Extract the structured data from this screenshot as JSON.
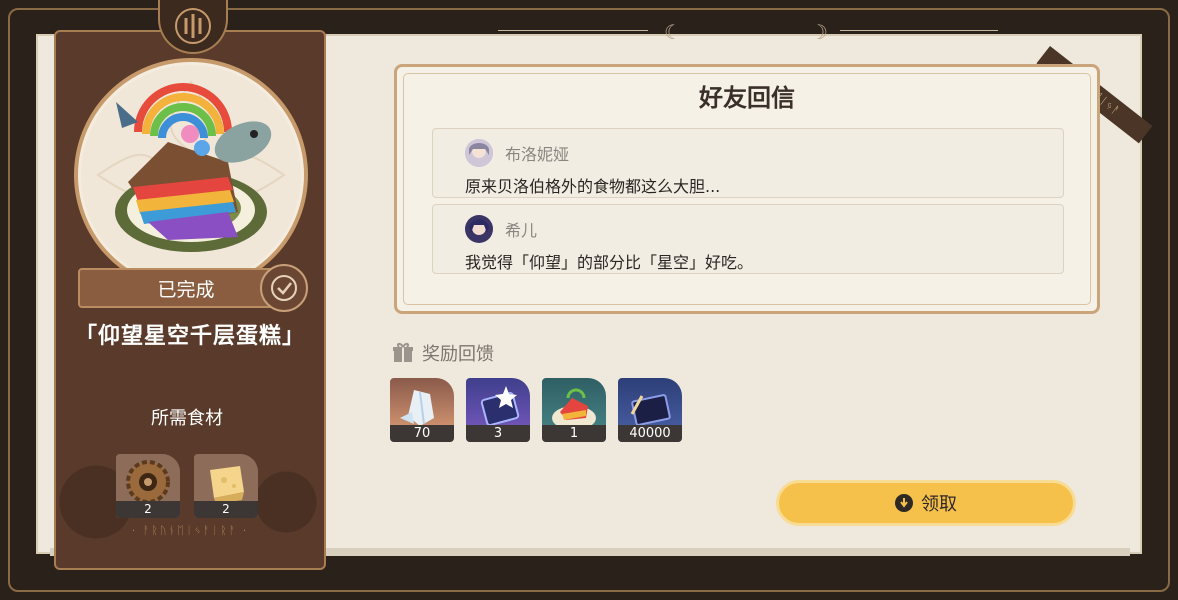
{
  "left_card": {
    "status": "已完成",
    "dish_name": "「仰望星空千层蛋糕」",
    "ingredients_title": "所需食材",
    "ingredients": [
      {
        "icon": "gear-icon",
        "count": "2"
      },
      {
        "icon": "cheese-icon",
        "count": "2"
      }
    ],
    "runes": "· ᚨᚱᚢᚾᛖᛁᛃᚨᛁᚱᚨ ·"
  },
  "corner_tag": "ᚨᚱᚢᚾᛖᛁᛃᚨ",
  "messages": {
    "title": "好友回信",
    "items": [
      {
        "sender": "布洛妮娅",
        "text": "原来贝洛伯格外的食物都这么大胆..."
      },
      {
        "sender": "希儿",
        "text": "我觉得「仰望」的部分比「星空」好吃。"
      }
    ]
  },
  "rewards": {
    "title": "奖励回馈",
    "items": [
      {
        "icon": "crystal-icon",
        "count": "70"
      },
      {
        "icon": "star-ticket-icon",
        "count": "3"
      },
      {
        "icon": "dish-icon",
        "count": "1"
      },
      {
        "icon": "exp-book-icon",
        "count": "40000"
      }
    ]
  },
  "claim_button": {
    "label": "领取"
  },
  "colors": {
    "accent": "#f6c14b",
    "card": "#5a3a2a",
    "paper": "#efe9dd"
  }
}
